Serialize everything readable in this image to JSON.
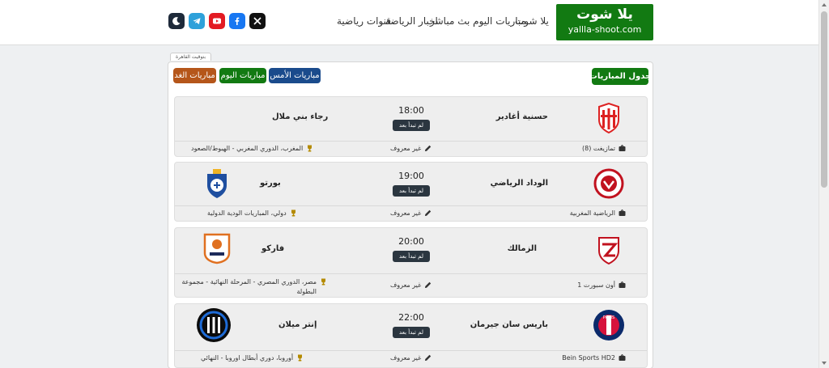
{
  "header": {
    "logo_title": "يلا شوت",
    "logo_subtitle": "yallla-shoot.com",
    "nav": [
      "يلا شوت",
      "مباريات اليوم بث مباشر",
      "اخبار الرياضة",
      "قنوات رياضية"
    ],
    "socials": [
      {
        "name": "dark-mode",
        "color": "#1e2a3a"
      },
      {
        "name": "telegram",
        "color": "#2ea1da"
      },
      {
        "name": "youtube",
        "color": "#e31b23"
      },
      {
        "name": "facebook",
        "color": "#1877f2"
      },
      {
        "name": "x",
        "color": "#111111"
      }
    ]
  },
  "timezone_label": "بتوقيت القاهرة",
  "schedule_title": "جدول المباريات",
  "day_tabs": {
    "yesterday": "مباريات الأمس",
    "today": "مباريات اليوم",
    "tomorrow": "مباريات الغد"
  },
  "colors": {
    "green": "#127a12",
    "blue": "#1a4b8c",
    "orange": "#b5561a"
  },
  "matches": [
    {
      "home": "حسنية أغادير",
      "away": "رجاء بني ملال",
      "time": "18:00",
      "status": "لم تبدأ بعد",
      "channel": "تمازيغت (8)",
      "commentator": "غير معروف",
      "competition": "المغرب، الدوري المغربي - الهبوط/الصعود",
      "home_crest": "hassania-crest-icon",
      "away_crest": ""
    },
    {
      "home": "الوداد الرياضي",
      "away": "بورتو",
      "time": "19:00",
      "status": "لم تبدأ بعد",
      "channel": "الرياضية المغربية",
      "commentator": "غير معروف",
      "competition": "دولي، المباريات الودية الدولية",
      "home_crest": "wydad-crest-icon",
      "away_crest": "porto-crest-icon"
    },
    {
      "home": "الزمالك",
      "away": "فاركو",
      "time": "20:00",
      "status": "لم تبدأ بعد",
      "channel": "أون سبورت 1",
      "commentator": "غير معروف",
      "competition": "مصر، الدوري المصري - المرحلة النهائية - مجموعة البطولة",
      "home_crest": "zamalek-crest-icon",
      "away_crest": "pharco-crest-icon"
    },
    {
      "home": "باريس سان جيرمان",
      "away": "إنتر ميلان",
      "time": "22:00",
      "status": "لم تبدأ بعد",
      "channel": "Bein Sports HD2",
      "commentator": "غير معروف",
      "competition": "أوروبا، دوري أبطال اوروبا - النهائي",
      "home_crest": "psg-crest-icon",
      "away_crest": "inter-crest-icon"
    }
  ]
}
